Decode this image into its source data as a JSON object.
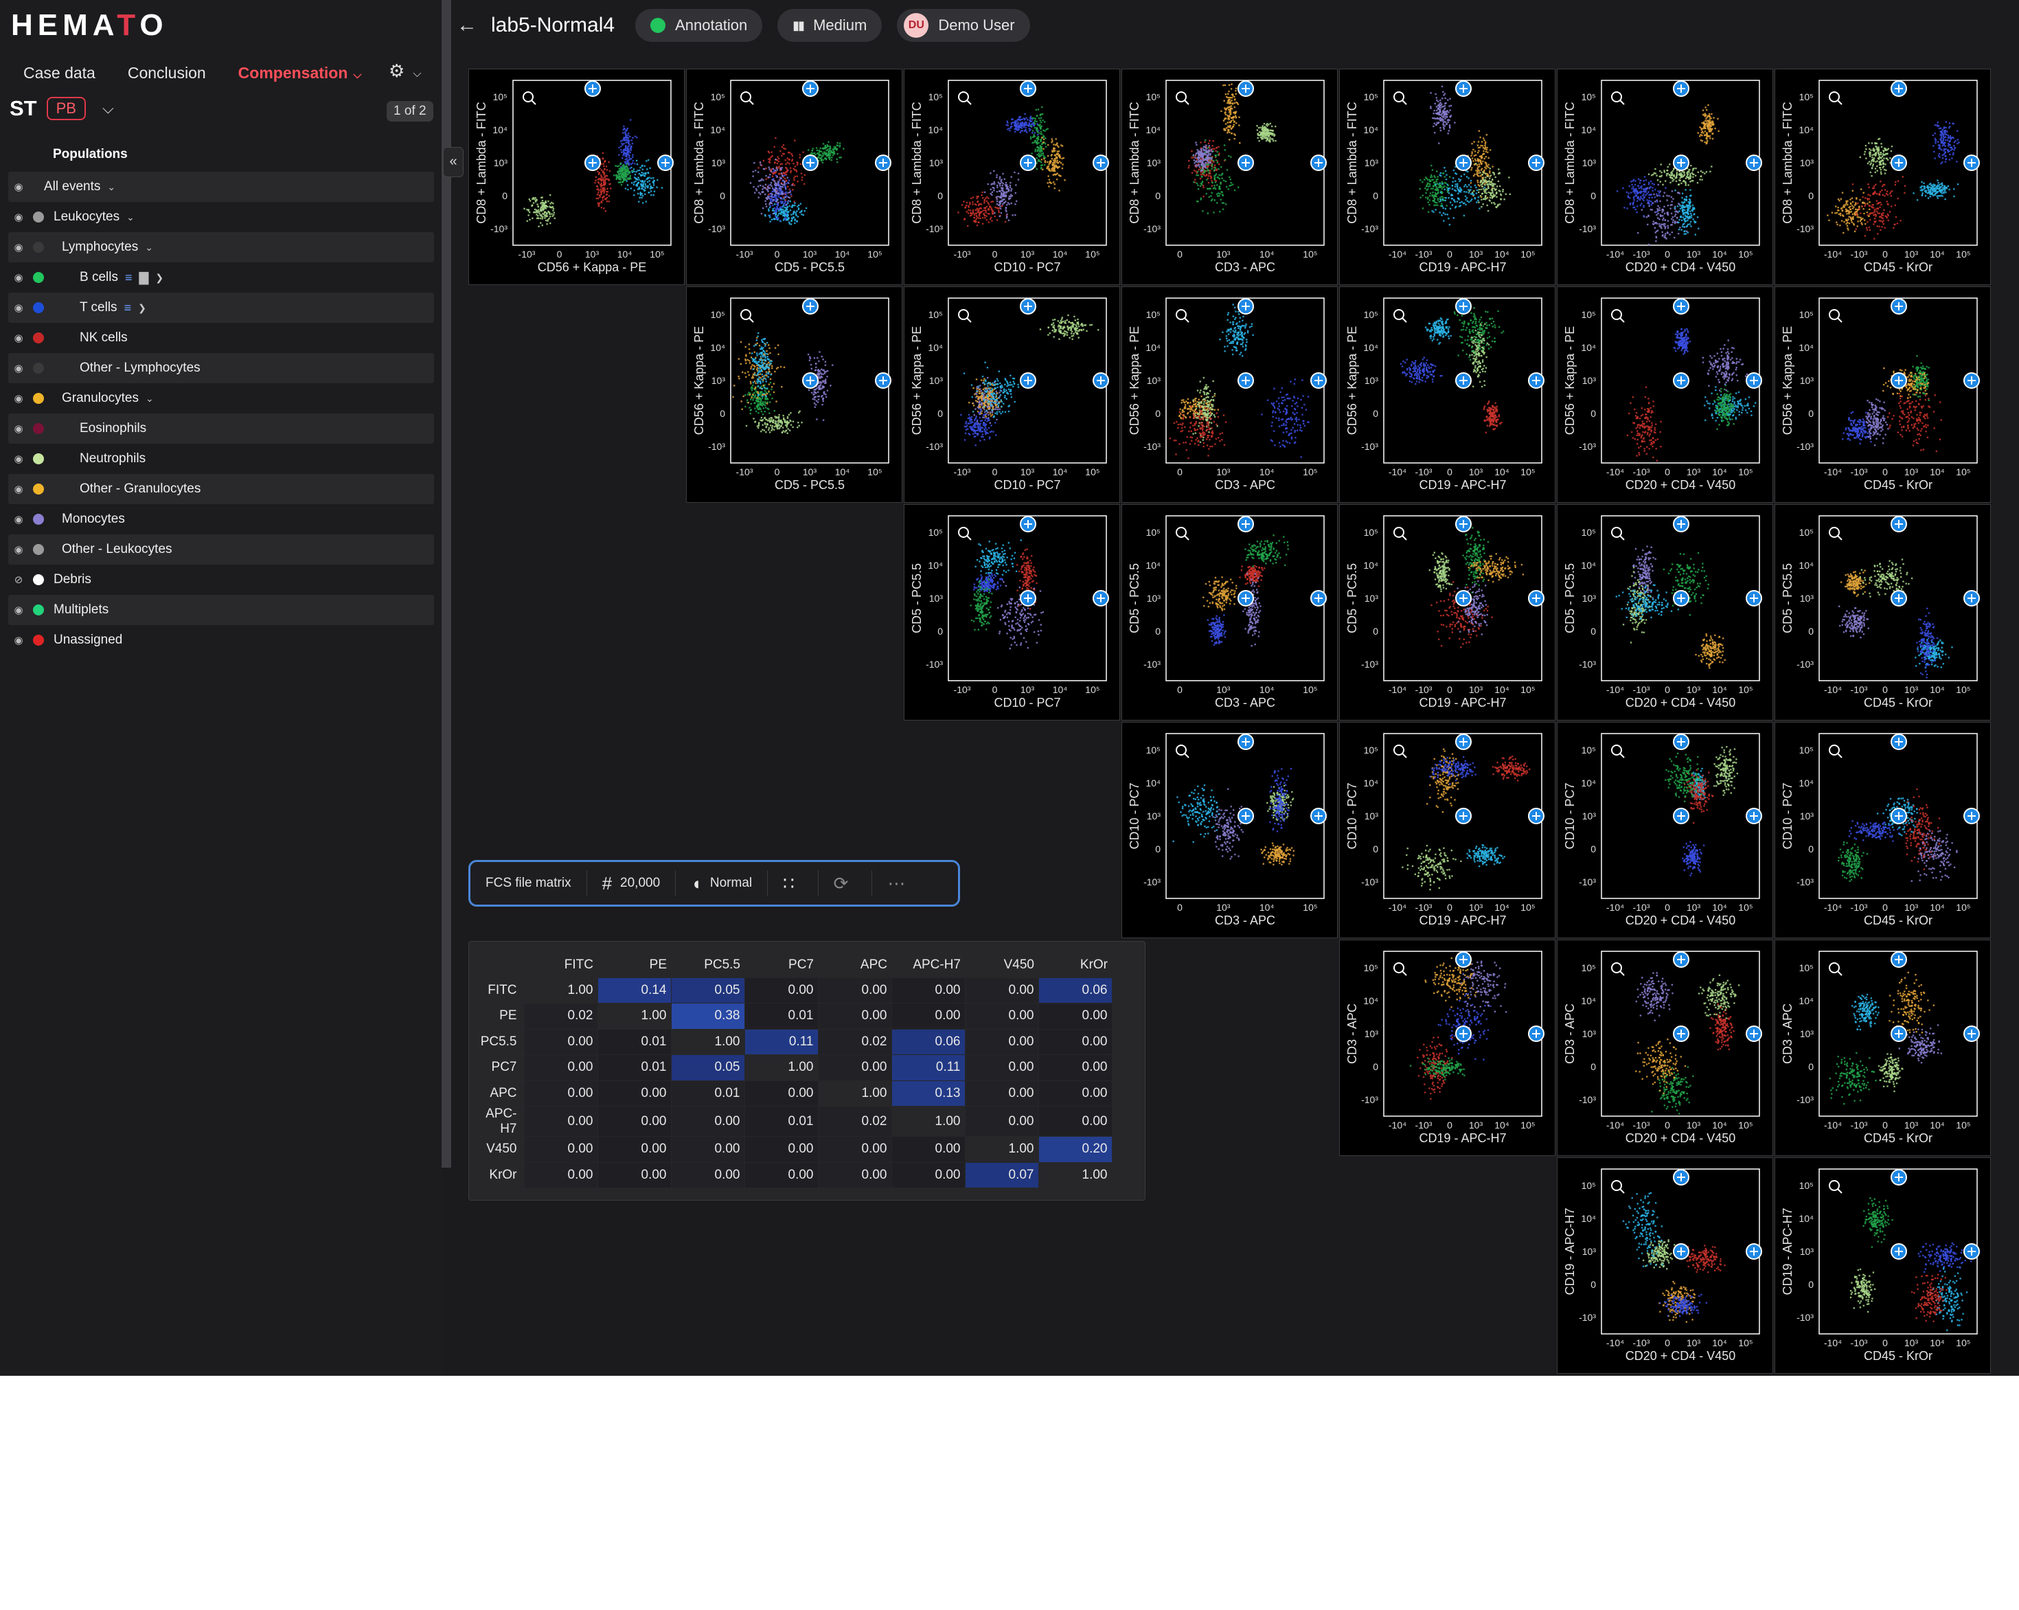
{
  "app": {
    "logo_left": "HEMA",
    "logo_mark": "T",
    "logo_right": "O"
  },
  "sidebar": {
    "tabs": [
      {
        "label": "Case data"
      },
      {
        "label": "Conclusion"
      },
      {
        "label": "Compensation",
        "active": true
      }
    ],
    "case_code": "ST",
    "tube": "PB",
    "page_indicator": "1 of 2",
    "populations_title": "Populations",
    "populations": [
      {
        "label": "All events",
        "color": "",
        "indent": 0,
        "visible": true,
        "expandable": true
      },
      {
        "label": "Leukocytes",
        "color": "#9a9a9a",
        "indent": 1,
        "visible": true,
        "expandable": true
      },
      {
        "label": "Lymphocytes",
        "color": "#3a3a3a",
        "indent": 2,
        "visible": true,
        "expandable": true
      },
      {
        "label": "B cells",
        "color": "#22c55e",
        "indent": 3,
        "visible": true,
        "icons": true,
        "arrow": true
      },
      {
        "label": "T cells",
        "color": "#1d4ed8",
        "indent": 3,
        "visible": true,
        "stack": true,
        "arrow": true
      },
      {
        "label": "NK cells",
        "color": "#c62828",
        "indent": 3,
        "visible": true
      },
      {
        "label": "Other - Lymphocytes",
        "color": "#3a3a3a",
        "indent": 3,
        "visible": true
      },
      {
        "label": "Granulocytes",
        "color": "#f0b429",
        "indent": 2,
        "visible": true,
        "expandable": true
      },
      {
        "label": "Eosinophils",
        "color": "#7a1236",
        "indent": 3,
        "visible": true
      },
      {
        "label": "Neutrophils",
        "color": "#c6e6a0",
        "indent": 3,
        "visible": true
      },
      {
        "label": "Other - Granulocytes",
        "color": "#f0b429",
        "indent": 3,
        "visible": true
      },
      {
        "label": "Monocytes",
        "color": "#8a7fd0",
        "indent": 2,
        "visible": true
      },
      {
        "label": "Other - Leukocytes",
        "color": "#9a9a9a",
        "indent": 2,
        "visible": true
      },
      {
        "label": "Debris",
        "color": "#ffffff",
        "indent": 1,
        "visible": false
      },
      {
        "label": "Multiplets",
        "color": "#22d37a",
        "indent": 1,
        "visible": true
      },
      {
        "label": "Unassigned",
        "color": "#e02424",
        "indent": 1,
        "visible": true
      }
    ]
  },
  "header": {
    "case_title": "lab5-Normal4",
    "status_chip": "Annotation",
    "priority_chip": "Medium",
    "user_initials": "DU",
    "user_name": "Demo User"
  },
  "plots": {
    "x_params": [
      "CD56 + Kappa - PE",
      "CD5 - PC5.5",
      "CD10 - PC7",
      "CD3 - APC",
      "CD19 - APC-H7",
      "CD20 + CD4 - V450",
      "CD45 - KrOr"
    ],
    "y_params": [
      "CD8 + Lambda - FITC",
      "CD56 + Kappa - PE",
      "CD5 - PC5.5",
      "CD10 - PC7",
      "CD3 - APC",
      "CD19 - APC-H7"
    ],
    "y_ticks": [
      "10⁵",
      "10⁴",
      "10³",
      "0",
      "-10³"
    ],
    "x_ticks_log": [
      "-10³",
      "0",
      "10³",
      "10⁴",
      "10⁵"
    ],
    "x_ticks_neg4": [
      "-10⁴",
      "-10³",
      "0",
      "10³",
      "10⁴",
      "10⁵"
    ],
    "x_ticks_short": [
      "0",
      "10³",
      "10⁴",
      "10⁵"
    ]
  },
  "toolbar": {
    "label": "FCS file matrix",
    "count": "20,000",
    "speed": "Normal"
  },
  "matrix": {
    "channels": [
      "FITC",
      "PE",
      "PC5.5",
      "PC7",
      "APC",
      "APC-H7",
      "V450",
      "KrOr"
    ],
    "rows": [
      [
        "1.00",
        "0.14",
        "0.05",
        "0.00",
        "0.00",
        "0.00",
        "0.00",
        "0.06"
      ],
      [
        "0.02",
        "1.00",
        "0.38",
        "0.01",
        "0.00",
        "0.00",
        "0.00",
        "0.00"
      ],
      [
        "0.00",
        "0.01",
        "1.00",
        "0.11",
        "0.02",
        "0.06",
        "0.00",
        "0.00"
      ],
      [
        "0.00",
        "0.01",
        "0.05",
        "1.00",
        "0.00",
        "0.11",
        "0.00",
        "0.00"
      ],
      [
        "0.00",
        "0.00",
        "0.01",
        "0.00",
        "1.00",
        "0.13",
        "0.00",
        "0.00"
      ],
      [
        "0.00",
        "0.00",
        "0.00",
        "0.01",
        "0.02",
        "1.00",
        "0.00",
        "0.00"
      ],
      [
        "0.00",
        "0.00",
        "0.00",
        "0.00",
        "0.00",
        "0.00",
        "1.00",
        "0.20"
      ],
      [
        "0.00",
        "0.00",
        "0.00",
        "0.00",
        "0.00",
        "0.00",
        "0.07",
        "1.00"
      ]
    ]
  }
}
